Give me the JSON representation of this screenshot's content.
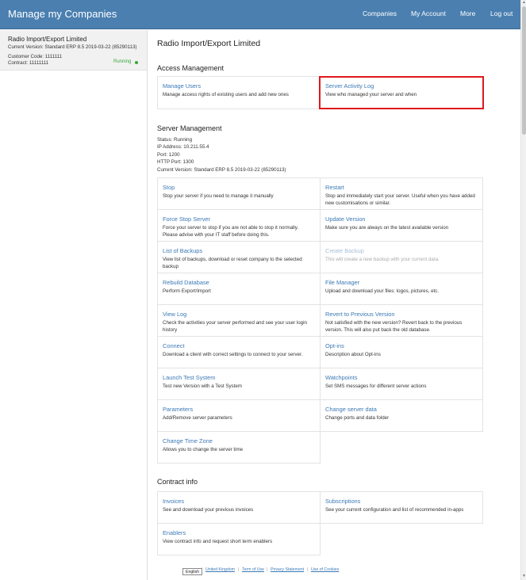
{
  "header": {
    "title": "Manage my Companies",
    "nav": {
      "companies": "Companies",
      "account": "My Account",
      "more": "More",
      "logout": "Log out"
    }
  },
  "sidebar": {
    "company": {
      "name": "Radio Import/Export Limited",
      "version": "Current Version: Standard ERP 8.5 2019-03-22 (85290113)",
      "customer_code": "Customer Code: 1111111",
      "contract": "Contract: 11111111",
      "status": "Running"
    }
  },
  "main": {
    "title": "Radio Import/Export Limited",
    "access": {
      "title": "Access Management",
      "items": [
        {
          "title": "Manage Users",
          "desc": "Manage access rights of existing users and add new ones"
        },
        {
          "title": "Server Activity Log",
          "desc": "View who managed your server and when"
        }
      ]
    },
    "server": {
      "title": "Server Management",
      "info": [
        "Status: Running",
        "IP Address: 10.211.55.4",
        "Port: 1200",
        "HTTP Port: 1300",
        "Current Version: Standard ERP 8.5 2019-03-22 (85290113)"
      ],
      "items": [
        {
          "title": "Stop",
          "desc": "Stop your server if you need to manage it manually"
        },
        {
          "title": "Restart",
          "desc": "Stop and immediately start your server. Useful when you have added new customisations or similar."
        },
        {
          "title": "Force Stop Server",
          "desc": "Force your server to stop if you are not able to stop it normally. Please advise with your IT staff before doing this."
        },
        {
          "title": "Update Version",
          "desc": "Make sure you are always on the latest available version"
        },
        {
          "title": "List of Backups",
          "desc": "View list of backups, download or reset company to the selected backup"
        },
        {
          "title": "Create Backup",
          "desc": "This will create a new backup with your current data."
        },
        {
          "title": "Rebuild Database",
          "desc": "Perform Export/Import"
        },
        {
          "title": "File Manager",
          "desc": "Upload and download your files: logos, pictures, etc."
        },
        {
          "title": "View Log",
          "desc": "Check the activities your server performed and see your user login history"
        },
        {
          "title": "Revert to Previous Version",
          "desc": "Not satisfied with the new version? Revert back to the previous version. This will also put back the old database."
        },
        {
          "title": "Connect",
          "desc": "Download a client with correct settings to connect to your server."
        },
        {
          "title": "Opt-ins",
          "desc": "Description about Opt-ins"
        },
        {
          "title": "Launch Test System",
          "desc": "Test new Version with a Test System"
        },
        {
          "title": "Watchpoints",
          "desc": "Set SMS messages for different server actions"
        },
        {
          "title": "Parameters",
          "desc": "Add/Remove server parameters"
        },
        {
          "title": "Change server data",
          "desc": "Change ports and data folder"
        },
        {
          "title": "Change Time Zone",
          "desc": "Allows you to change the server time"
        }
      ]
    },
    "contract": {
      "title": "Contract info",
      "items": [
        {
          "title": "Invoices",
          "desc": "See and download your previous invoices"
        },
        {
          "title": "Subscriptions",
          "desc": "See your current configuration and list of recommended in-apps"
        },
        {
          "title": "Enablers",
          "desc": "View contract info and request short term enablers"
        }
      ]
    }
  },
  "footer": {
    "language": "English",
    "links": [
      "United Kingdom",
      "Term of Use",
      "Privacy Statement",
      "Use of Cookies"
    ]
  },
  "colors": {
    "header_bg": "#4a7fb0",
    "link": "#3b79b5",
    "running": "#3aa63a",
    "highlight": "#e0191b"
  }
}
